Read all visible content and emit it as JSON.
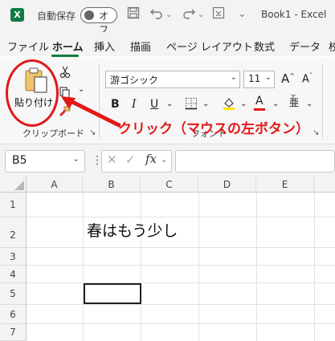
{
  "titlebar": {
    "app_icon": "excel-icon",
    "autosave_label": "自動保存",
    "autosave_state": "オフ",
    "book_name": "Book1",
    "separator": "-",
    "app_name": "Excel"
  },
  "menu": {
    "items": [
      "ファイル",
      "ホーム",
      "挿入",
      "描画",
      "ページ レイアウト",
      "数式",
      "データ",
      "校"
    ],
    "active": "ホーム"
  },
  "ribbon": {
    "paste_label": "貼り付け",
    "clipboard_group_label": "クリップボード",
    "font_name": "游ゴシック",
    "font_size": "11",
    "grow_font": "A^",
    "shrink_font": "Aˇ",
    "bold": "B",
    "italic": "I",
    "underline": "U",
    "font_color_letter": "A",
    "phonetic_label": "亜",
    "font_group_label": "フォント",
    "highlight_color": "#ffe000",
    "font_color": "#e21818"
  },
  "annotation": {
    "text": "クリック（マウスの左ボタン）",
    "color": "#e21818"
  },
  "formula_bar": {
    "name_box": "B5",
    "fx_label": "fx",
    "formula": ""
  },
  "sheet": {
    "columns": [
      "A",
      "B",
      "C",
      "D",
      "E"
    ],
    "rows": [
      "1",
      "2",
      "3",
      "4",
      "5",
      "6",
      "7"
    ],
    "cell_b2": "春はもう少し",
    "selected_cell": "B5"
  }
}
